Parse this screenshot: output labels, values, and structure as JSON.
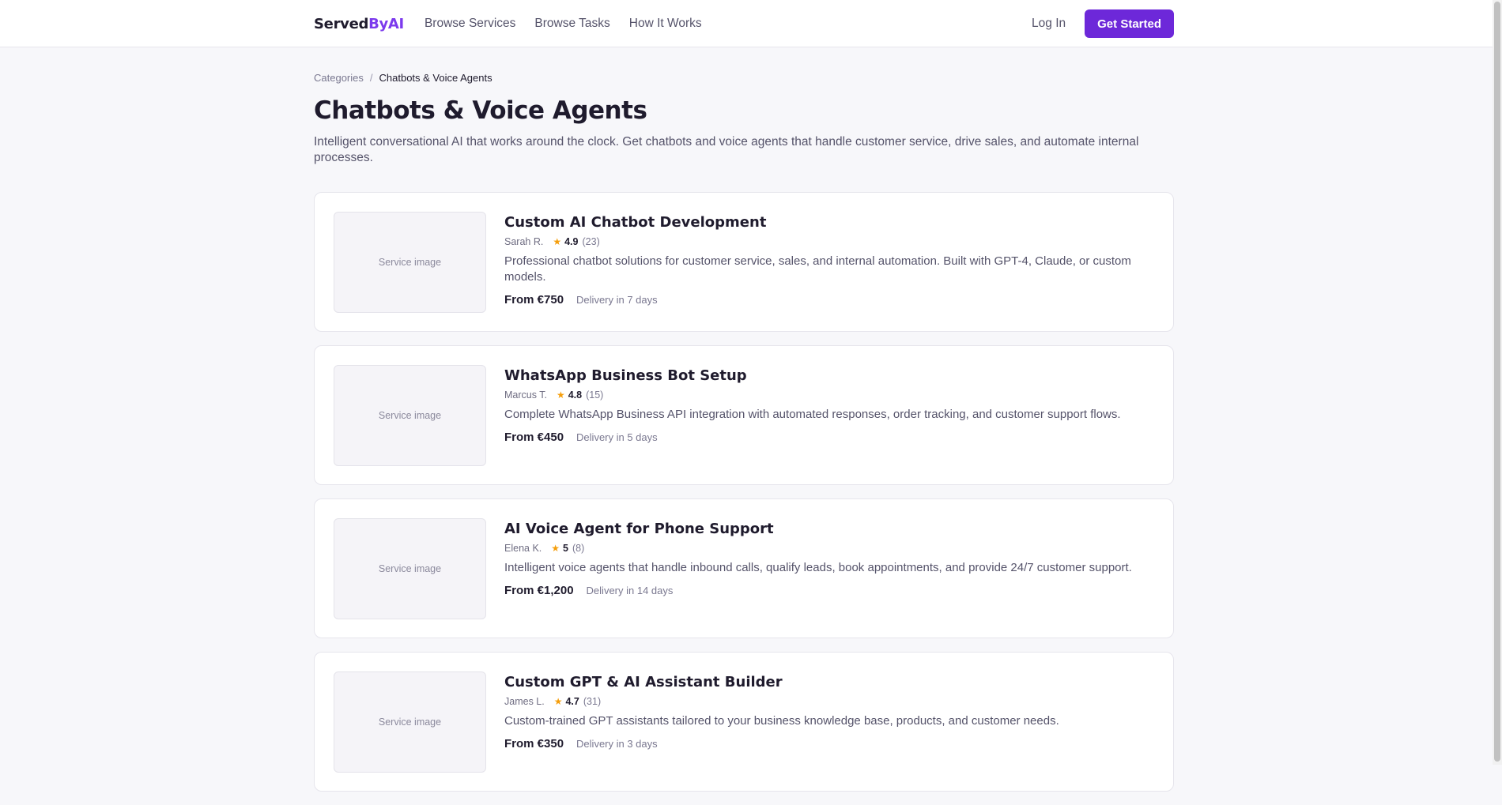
{
  "header": {
    "logo_main": "Served",
    "logo_accent": "ByAI",
    "nav": [
      "Browse Services",
      "Browse Tasks",
      "How It Works"
    ],
    "login_label": "Log In",
    "cta_label": "Get Started"
  },
  "breadcrumb": {
    "parent": "Categories",
    "separator": "/",
    "current": "Chatbots & Voice Agents"
  },
  "page": {
    "title": "Chatbots & Voice Agents",
    "description": "Intelligent conversational AI that works around the clock. Get chatbots and voice agents that handle customer service, drive sales, and automate internal processes."
  },
  "services": [
    {
      "image_label": "Service image",
      "title": "Custom AI Chatbot Development",
      "seller": "Sarah R.",
      "rating": "4.9",
      "reviews": "(23)",
      "description": "Professional chatbot solutions for customer service, sales, and internal automation. Built with GPT-4, Claude, or custom models.",
      "price": "From €750",
      "delivery": "Delivery in 7 days"
    },
    {
      "image_label": "Service image",
      "title": "WhatsApp Business Bot Setup",
      "seller": "Marcus T.",
      "rating": "4.8",
      "reviews": "(15)",
      "description": "Complete WhatsApp Business API integration with automated responses, order tracking, and customer support flows.",
      "price": "From €450",
      "delivery": "Delivery in 5 days"
    },
    {
      "image_label": "Service image",
      "title": "AI Voice Agent for Phone Support",
      "seller": "Elena K.",
      "rating": "5",
      "reviews": "(8)",
      "description": "Intelligent voice agents that handle inbound calls, qualify leads, book appointments, and provide 24/7 customer support.",
      "price": "From €1,200",
      "delivery": "Delivery in 14 days"
    },
    {
      "image_label": "Service image",
      "title": "Custom GPT & AI Assistant Builder",
      "seller": "James L.",
      "rating": "4.7",
      "reviews": "(31)",
      "description": "Custom-trained GPT assistants tailored to your business knowledge base, products, and customer needs.",
      "price": "From €350",
      "delivery": "Delivery in 3 days"
    }
  ],
  "colors": {
    "accent": "#6d28d9",
    "logo_accent": "#7c3aed",
    "star": "#f59e0b",
    "background": "#f7f7fa"
  },
  "icons": {
    "rating": "star-icon"
  }
}
